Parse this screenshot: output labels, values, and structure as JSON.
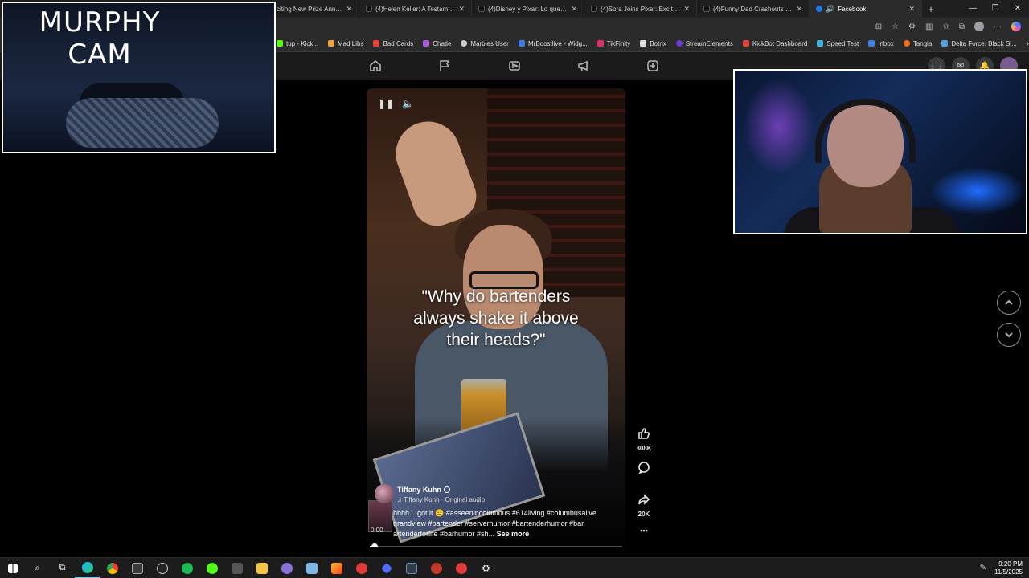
{
  "browser": {
    "tabs": [
      {
        "title": "citing New Prize Announc",
        "active": false
      },
      {
        "title": "(4)Helen Keller: A Testament of",
        "active": false
      },
      {
        "title": "(4)Disney y Pixar: Lo que no p",
        "active": false
      },
      {
        "title": "(4)Sora Joins Pixar: Exciting Ne",
        "active": false
      },
      {
        "title": "(4)Funny Dad Crashouts Comp",
        "active": false
      },
      {
        "title": "Facebook",
        "active": true
      }
    ],
    "new_tab": "+",
    "window_controls": {
      "minimize": "—",
      "maximize": "❐",
      "close": "✕"
    },
    "bookmarks": [
      {
        "label": "tup - Kick...",
        "color": "#53fc18"
      },
      {
        "label": "Mad Libs",
        "color": "#f2a23a"
      },
      {
        "label": "Bad Cards",
        "color": "#e0453a"
      },
      {
        "label": "Chatle",
        "color": "#a55bd6"
      },
      {
        "label": "Marbles User",
        "color": "#cccccc"
      },
      {
        "label": "MrBoostlive - Widg...",
        "color": "#3b7de0"
      },
      {
        "label": "TikFinity",
        "color": "#e0306a"
      },
      {
        "label": "Botrix",
        "color": "#dddddd"
      },
      {
        "label": "StreamElements",
        "color": "#6c3bd6"
      },
      {
        "label": "KickBot Dashboard",
        "color": "#e0453a"
      },
      {
        "label": "Speed Test",
        "color": "#3bb3e0"
      },
      {
        "label": "Inbox",
        "color": "#3b7de0"
      },
      {
        "label": "Tangia",
        "color": "#f26b1d"
      },
      {
        "label": "Delta Force: Black Si...",
        "color": "#4fa3e0"
      }
    ],
    "bookmarks_more": "›"
  },
  "overlays": {
    "murphy_cam_title": "MURPHY CAM"
  },
  "reel": {
    "caption_line1": "\"Why do bartenders",
    "caption_line2": "always shake it above",
    "caption_line3": "their heads?\"",
    "author_name": "Tiffany Kuhn",
    "audio": "♫ Tiffany Kuhn · Original audio",
    "description": "hhhh....got it 😉 #asseenincolumbus #614living #columbusalive grandview #bartender #serverhumor #bartenderhumor #bar artenderforlife #barhumor #sh...",
    "see_more": "See more",
    "time": "0:00",
    "progress": 0.02,
    "likes": "308K",
    "shares": "20K",
    "more": "•••"
  },
  "taskbar": {
    "clock_time": "9:20 PM",
    "clock_date": "11/5/2025"
  }
}
